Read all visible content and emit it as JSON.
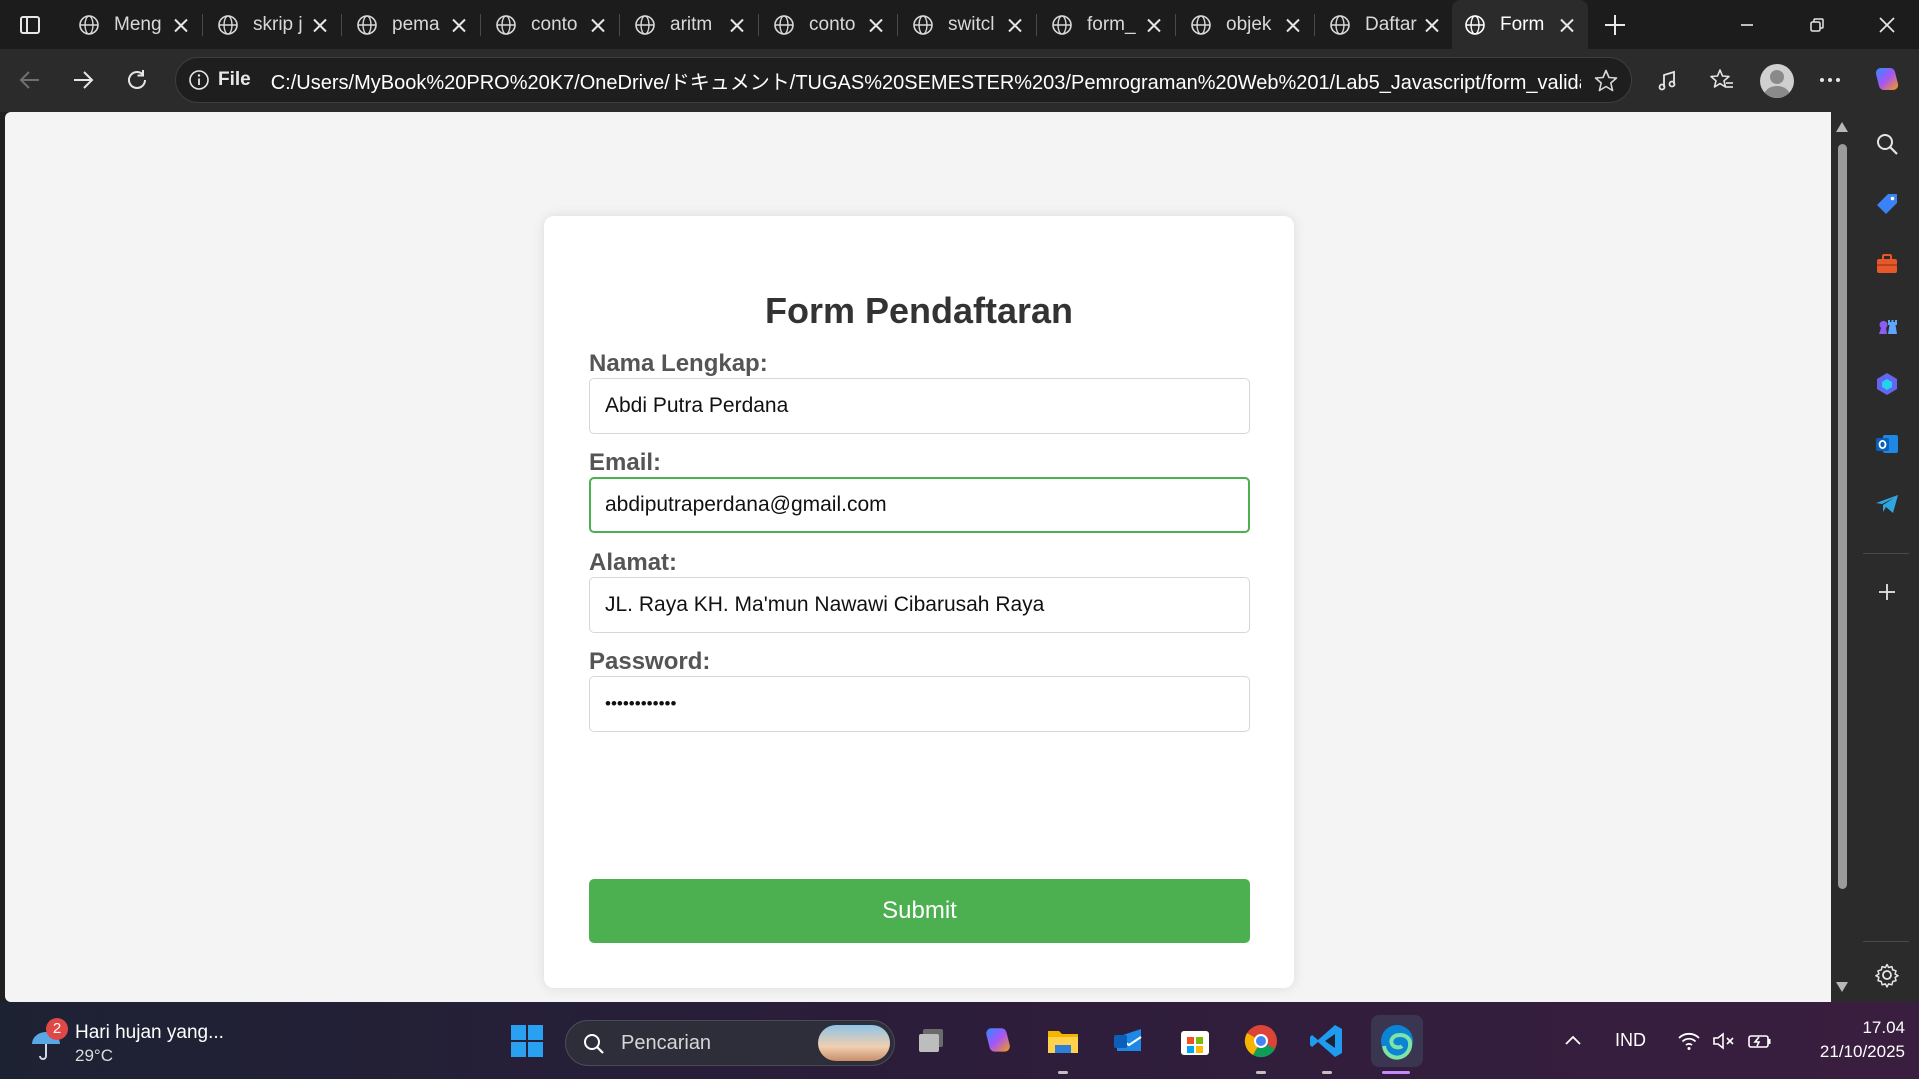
{
  "browser": {
    "tabs": [
      {
        "label": "Meng",
        "active": false
      },
      {
        "label": "skrip j",
        "active": false
      },
      {
        "label": "pema",
        "active": false
      },
      {
        "label": "conto",
        "active": false
      },
      {
        "label": "aritm",
        "active": false
      },
      {
        "label": "conto",
        "active": false
      },
      {
        "label": "switcl",
        "active": false
      },
      {
        "label": "form_",
        "active": false
      },
      {
        "label": "objek",
        "active": false
      },
      {
        "label": "Daftar",
        "active": false
      },
      {
        "label": "Form",
        "active": true
      }
    ],
    "address_bar": {
      "scheme_label": "File",
      "url": "C:/Users/MyBook%20PRO%20K7/OneDrive/ドキュメント/TUGAS%20SEMESTER%203/Pemrograman%20Web%201/Lab5_Javascript/form_valida..."
    }
  },
  "form": {
    "title": "Form Pendaftaran",
    "fields": {
      "nama": {
        "label": "Nama Lengkap:",
        "value": "Abdi Putra Perdana"
      },
      "email": {
        "label": "Email:",
        "value": "abdiputraperdana@gmail.com"
      },
      "alamat": {
        "label": "Alamat:",
        "value": "JL. Raya KH. Ma'mun Nawawi Cibarusah Raya"
      },
      "password": {
        "label": "Password:",
        "value": "••••••••••••"
      }
    },
    "submit_label": "Submit"
  },
  "taskbar": {
    "weather": {
      "badge": "2",
      "title": "Hari hujan yang...",
      "temp": "29°C"
    },
    "search_placeholder": "Pencarian",
    "language": "IND",
    "time": "17.04",
    "date": "21/10/2025"
  },
  "colors": {
    "accent_green": "#4caf50",
    "page_background": "#f4f4f4",
    "browser_chrome": "#2b2b2b"
  }
}
